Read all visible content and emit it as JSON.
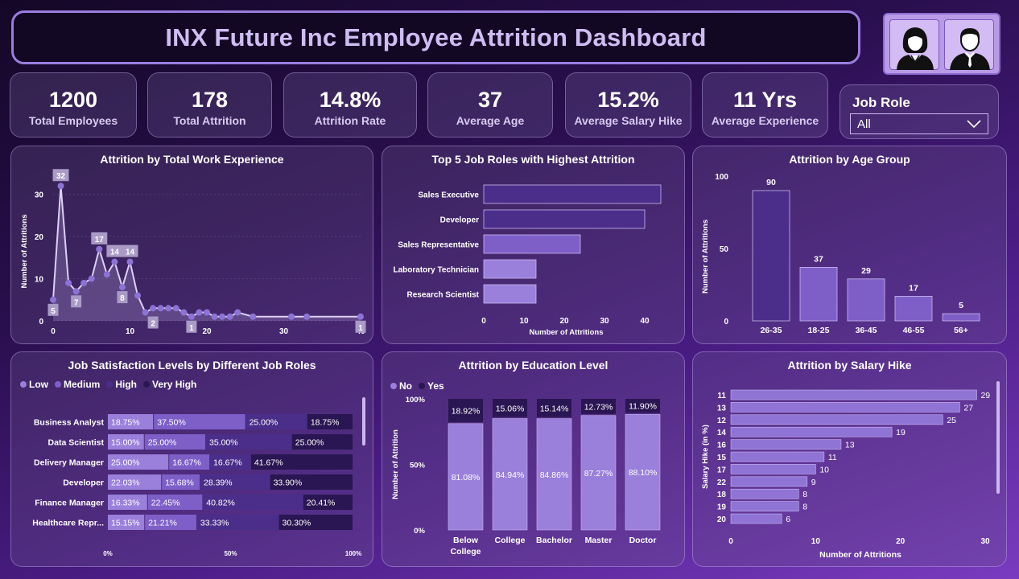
{
  "header": {
    "title": "INX Future Inc Employee Attrition Dashboard"
  },
  "kpis": [
    {
      "value": "1200",
      "label": "Total Employees"
    },
    {
      "value": "178",
      "label": "Total Attrition"
    },
    {
      "value": "14.8%",
      "label": "Attrition Rate"
    },
    {
      "value": "37",
      "label": "Average Age"
    },
    {
      "value": "15.2%",
      "label": "Average Salary Hike"
    },
    {
      "value": "11 Yrs",
      "label": "Average Experience"
    }
  ],
  "filter": {
    "label": "Job Role",
    "value": "All"
  },
  "colors": {
    "accent": "#8b6ad0",
    "bar_dark": "#4b2e8a",
    "bar_mid": "#7e5fc8",
    "bar_light": "#9a7fdb"
  },
  "chart_data": [
    {
      "id": "experience",
      "type": "line",
      "title": "Attrition by Total Work Experience",
      "ylabel": "Number of Attritions",
      "xlabel": "",
      "xlim": [
        0,
        40
      ],
      "ylim": [
        0,
        33
      ],
      "xticks": [
        "0",
        "10",
        "20",
        "30",
        "40"
      ],
      "yticks": [
        "0",
        "10",
        "20",
        "30"
      ],
      "x": [
        0,
        1,
        2,
        3,
        4,
        5,
        6,
        7,
        8,
        9,
        10,
        11,
        12,
        13,
        14,
        15,
        16,
        17,
        18,
        19,
        20,
        21,
        22,
        23,
        24,
        26,
        31,
        33,
        40
      ],
      "y": [
        5,
        32,
        9,
        7,
        9,
        10,
        17,
        11,
        14,
        8,
        14,
        6,
        2,
        3,
        3,
        3,
        3,
        2,
        1,
        2,
        2,
        1,
        1,
        1,
        2,
        1,
        1,
        1,
        1
      ],
      "data_labels": [
        {
          "x": 0,
          "y": 5,
          "text": "5"
        },
        {
          "x": 1,
          "y": 32,
          "text": "32"
        },
        {
          "x": 3,
          "y": 7,
          "text": "7"
        },
        {
          "x": 6,
          "y": 17,
          "text": "17"
        },
        {
          "x": 8,
          "y": 14,
          "text": "14"
        },
        {
          "x": 9,
          "y": 8,
          "text": "8"
        },
        {
          "x": 10,
          "y": 14,
          "text": "14"
        },
        {
          "x": 13,
          "y": 2,
          "text": "2"
        },
        {
          "x": 18,
          "y": 1,
          "text": "1"
        },
        {
          "x": 40,
          "y": 1,
          "text": "1"
        }
      ]
    },
    {
      "id": "top_roles",
      "type": "bar",
      "orientation": "horizontal",
      "title": "Top 5 Job Roles with Highest Attrition",
      "categories": [
        "Sales Executive",
        "Developer",
        "Sales Representative",
        "Laboratory Technician",
        "Research Scientist"
      ],
      "values": [
        44,
        40,
        24,
        13,
        13
      ],
      "xlabel": "Number of Attritions",
      "xlim": [
        0,
        45
      ],
      "xticks": [
        "0",
        "10",
        "20",
        "30",
        "40"
      ]
    },
    {
      "id": "age",
      "type": "bar",
      "title": "Attrition by Age Group",
      "categories": [
        "26-35",
        "18-25",
        "36-45",
        "46-55",
        "56+"
      ],
      "values": [
        90,
        37,
        29,
        17,
        5
      ],
      "ylabel": "Number of Attritions",
      "ylim": [
        0,
        100
      ],
      "yticks": [
        "0",
        "50",
        "100"
      ]
    },
    {
      "id": "satisfaction",
      "type": "bar",
      "stacked": "100%",
      "orientation": "horizontal",
      "title": "Job Satisfaction Levels by Different Job Roles",
      "legend": [
        "Low",
        "Medium",
        "High",
        "Very High"
      ],
      "categories": [
        "Business Analyst",
        "Data Scientist",
        "Delivery Manager",
        "Developer",
        "Finance Manager",
        "Healthcare Repr..."
      ],
      "series": [
        {
          "name": "Low",
          "values": [
            18.75,
            15.0,
            25.0,
            22.03,
            16.33,
            15.15
          ]
        },
        {
          "name": "Medium",
          "values": [
            37.5,
            25.0,
            16.67,
            15.68,
            22.45,
            21.21
          ]
        },
        {
          "name": "High",
          "values": [
            25.0,
            35.0,
            16.67,
            28.39,
            40.82,
            33.33
          ]
        },
        {
          "name": "Very High",
          "values": [
            18.75,
            25.0,
            41.67,
            33.9,
            20.41,
            30.3
          ]
        }
      ],
      "labels": [
        [
          "18.75%",
          "37.50%",
          "25.00%",
          "18.75%"
        ],
        [
          "15.00%",
          "25.00%",
          "35.00%",
          "25.00%"
        ],
        [
          "25.00%",
          "16.67%",
          "16.67%",
          "41.67%"
        ],
        [
          "22.03%",
          "15.68%",
          "28.39%",
          "33.90%"
        ],
        [
          "16.33%",
          "22.45%",
          "40.82%",
          "20.41%"
        ],
        [
          "15.15%",
          "21.21%",
          "33.33%",
          "30.30%"
        ]
      ],
      "xticks": [
        "0%",
        "50%",
        "100%"
      ]
    },
    {
      "id": "education",
      "type": "bar",
      "stacked": "100%",
      "title": "Attrition by Education Level",
      "legend": [
        "No",
        "Yes"
      ],
      "categories": [
        "Below College",
        "College",
        "Bachelor",
        "Master",
        "Doctor"
      ],
      "category_lines": [
        [
          "Below",
          "College"
        ],
        [
          "College"
        ],
        [
          "Bachelor"
        ],
        [
          "Master"
        ],
        [
          "Doctor"
        ]
      ],
      "series": [
        {
          "name": "No",
          "values": [
            81.08,
            84.94,
            84.86,
            87.27,
            88.1
          ]
        },
        {
          "name": "Yes",
          "values": [
            18.92,
            15.06,
            15.14,
            12.73,
            11.9
          ]
        }
      ],
      "labels_no": [
        "81.08%",
        "84.94%",
        "84.86%",
        "87.27%",
        "88.10%"
      ],
      "labels_yes": [
        "18.92%",
        "15.06%",
        "15.14%",
        "12.73%",
        "11.90%"
      ],
      "ylabel": "Number of Attrition",
      "yticks": [
        "0%",
        "50%",
        "100%"
      ]
    },
    {
      "id": "salary",
      "type": "bar",
      "orientation": "horizontal",
      "title": "Attrition by Salary Hike",
      "categories": [
        "11",
        "13",
        "12",
        "14",
        "16",
        "15",
        "17",
        "22",
        "18",
        "19",
        "20"
      ],
      "values": [
        29,
        27,
        25,
        19,
        13,
        11,
        10,
        9,
        8,
        8,
        6
      ],
      "xlabel": "Number of Attritions",
      "ylabel": "Salary Hike (in %)",
      "xlim": [
        0,
        30
      ],
      "xticks": [
        "0",
        "10",
        "20",
        "30"
      ]
    }
  ]
}
